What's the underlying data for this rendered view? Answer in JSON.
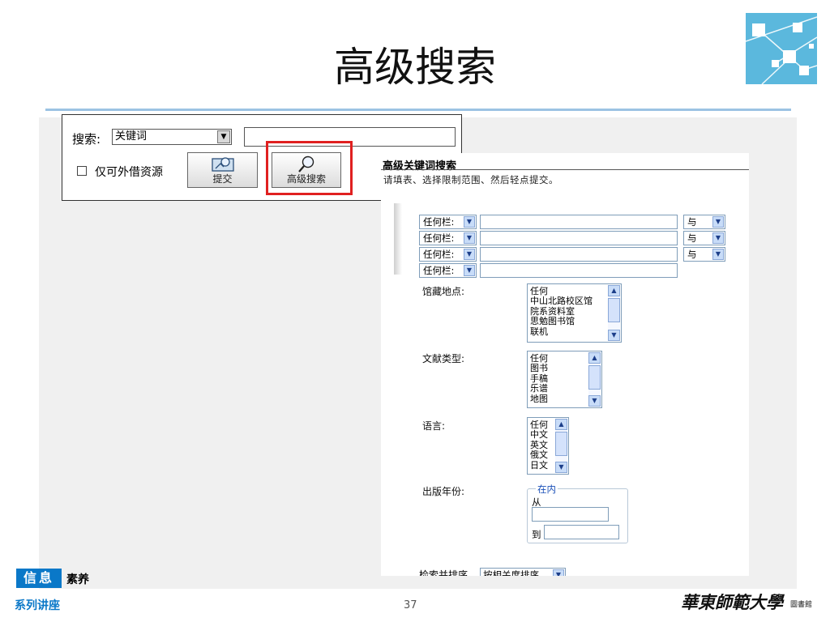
{
  "slide": {
    "title": "高级搜索",
    "page_number": "37"
  },
  "footer": {
    "badge": "信息",
    "badge_suffix": "素养",
    "series": "系列讲座",
    "university": "華東師範大學",
    "library": "圖書館"
  },
  "basic_search": {
    "label": "搜索:",
    "field_selected": "关键词",
    "query_value": "",
    "loanable_label": "仅可外借资源",
    "loanable_checked": false,
    "submit_label": "提交",
    "advanced_label": "高级搜索"
  },
  "advanced": {
    "title": "高级关键词搜索",
    "instruction": "请填表、选择限制范围、然后轻点提交。",
    "rows": [
      {
        "field": "任何栏:",
        "value": "",
        "bool": "与"
      },
      {
        "field": "任何栏:",
        "value": "",
        "bool": "与"
      },
      {
        "field": "任何栏:",
        "value": "",
        "bool": "与"
      },
      {
        "field": "任何栏:",
        "value": ""
      }
    ],
    "location_label": "馆藏地点:",
    "location_options": [
      "任何",
      "中山北路校区馆",
      "院系资料室",
      "思勉图书馆",
      "联机"
    ],
    "doctype_label": "文献类型:",
    "doctype_options": [
      "任何",
      "图书",
      "手稿",
      "乐谱",
      "地图"
    ],
    "language_label": "语言:",
    "language_options": [
      "任何",
      "中文",
      "英文",
      "俄文",
      "日文"
    ],
    "year_label": "出版年份:",
    "year_legend": "在内",
    "year_from_label": "从",
    "year_to_label": "到",
    "sort_label": "检索并排序",
    "sort_value": "按相关度排序"
  },
  "colors": {
    "accent_blue": "#0a78c8",
    "highlight_red": "#e02020",
    "logo_blue": "#5bb8dd",
    "rule_blue": "#9cc3e3"
  },
  "icons": [
    "network-logo-icon",
    "submit-icon",
    "magnifier-icon",
    "chevron-down-icon",
    "chevron-up-icon"
  ]
}
